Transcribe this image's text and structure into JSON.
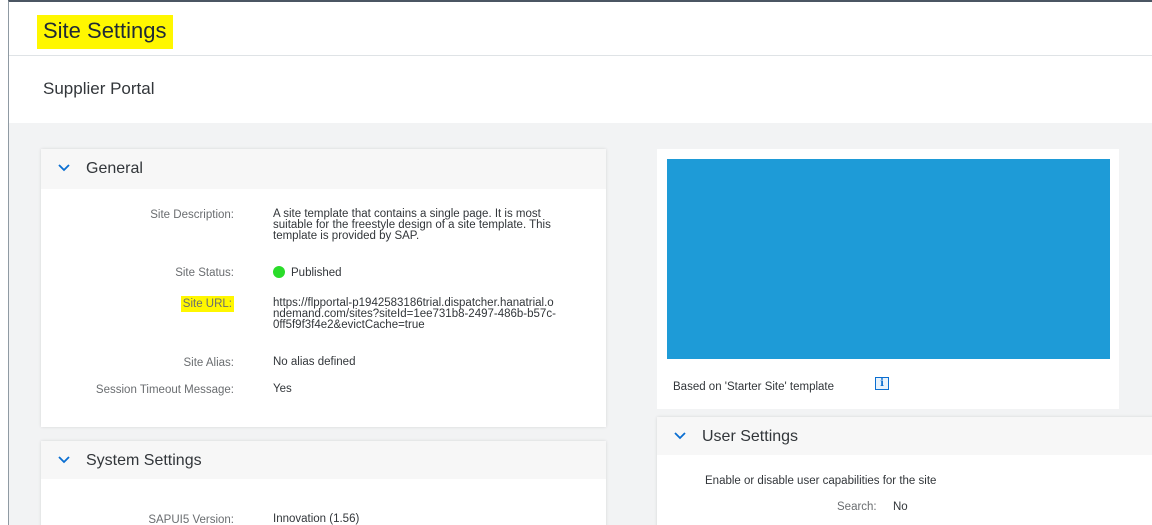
{
  "header": {
    "title": "Site Settings"
  },
  "site": {
    "name": "Supplier Portal"
  },
  "general": {
    "title": "General",
    "fields": {
      "description_label": "Site Description:",
      "description_line1": "A site template that contains a single page. It is most",
      "description_line2": "suitable for the freestyle design of a site template. This",
      "description_line3": "template is provided by SAP.",
      "status_label": "Site Status:",
      "status_value": "Published",
      "url_label": "Site URL:",
      "url_line1": "https://flpportal-p1942583186trial.dispatcher.hanatrial.o",
      "url_line2": "ndemand.com/sites?siteId=1ee731b8-2497-486b-b57c-",
      "url_line3": "0ff5f9f3f4e2&evictCache=true",
      "alias_label": "Site Alias:",
      "alias_value": "No alias defined",
      "timeout_label": "Session Timeout Message:",
      "timeout_value": "Yes"
    }
  },
  "system": {
    "title": "System Settings",
    "sapui5_label": "SAPUI5 Version:",
    "sapui5_value": "Innovation (1.56)"
  },
  "preview": {
    "template_text": "Based on 'Starter Site' template",
    "info_icon": "i"
  },
  "user_settings": {
    "title": "User Settings",
    "description": "Enable or disable user capabilities for the site",
    "search_label": "Search:",
    "search_value": "No"
  },
  "colors": {
    "highlight": "#fff700",
    "preview_blue": "#1e9bd7",
    "status_green": "#2adc2a",
    "accent": "#0a6ed1"
  }
}
